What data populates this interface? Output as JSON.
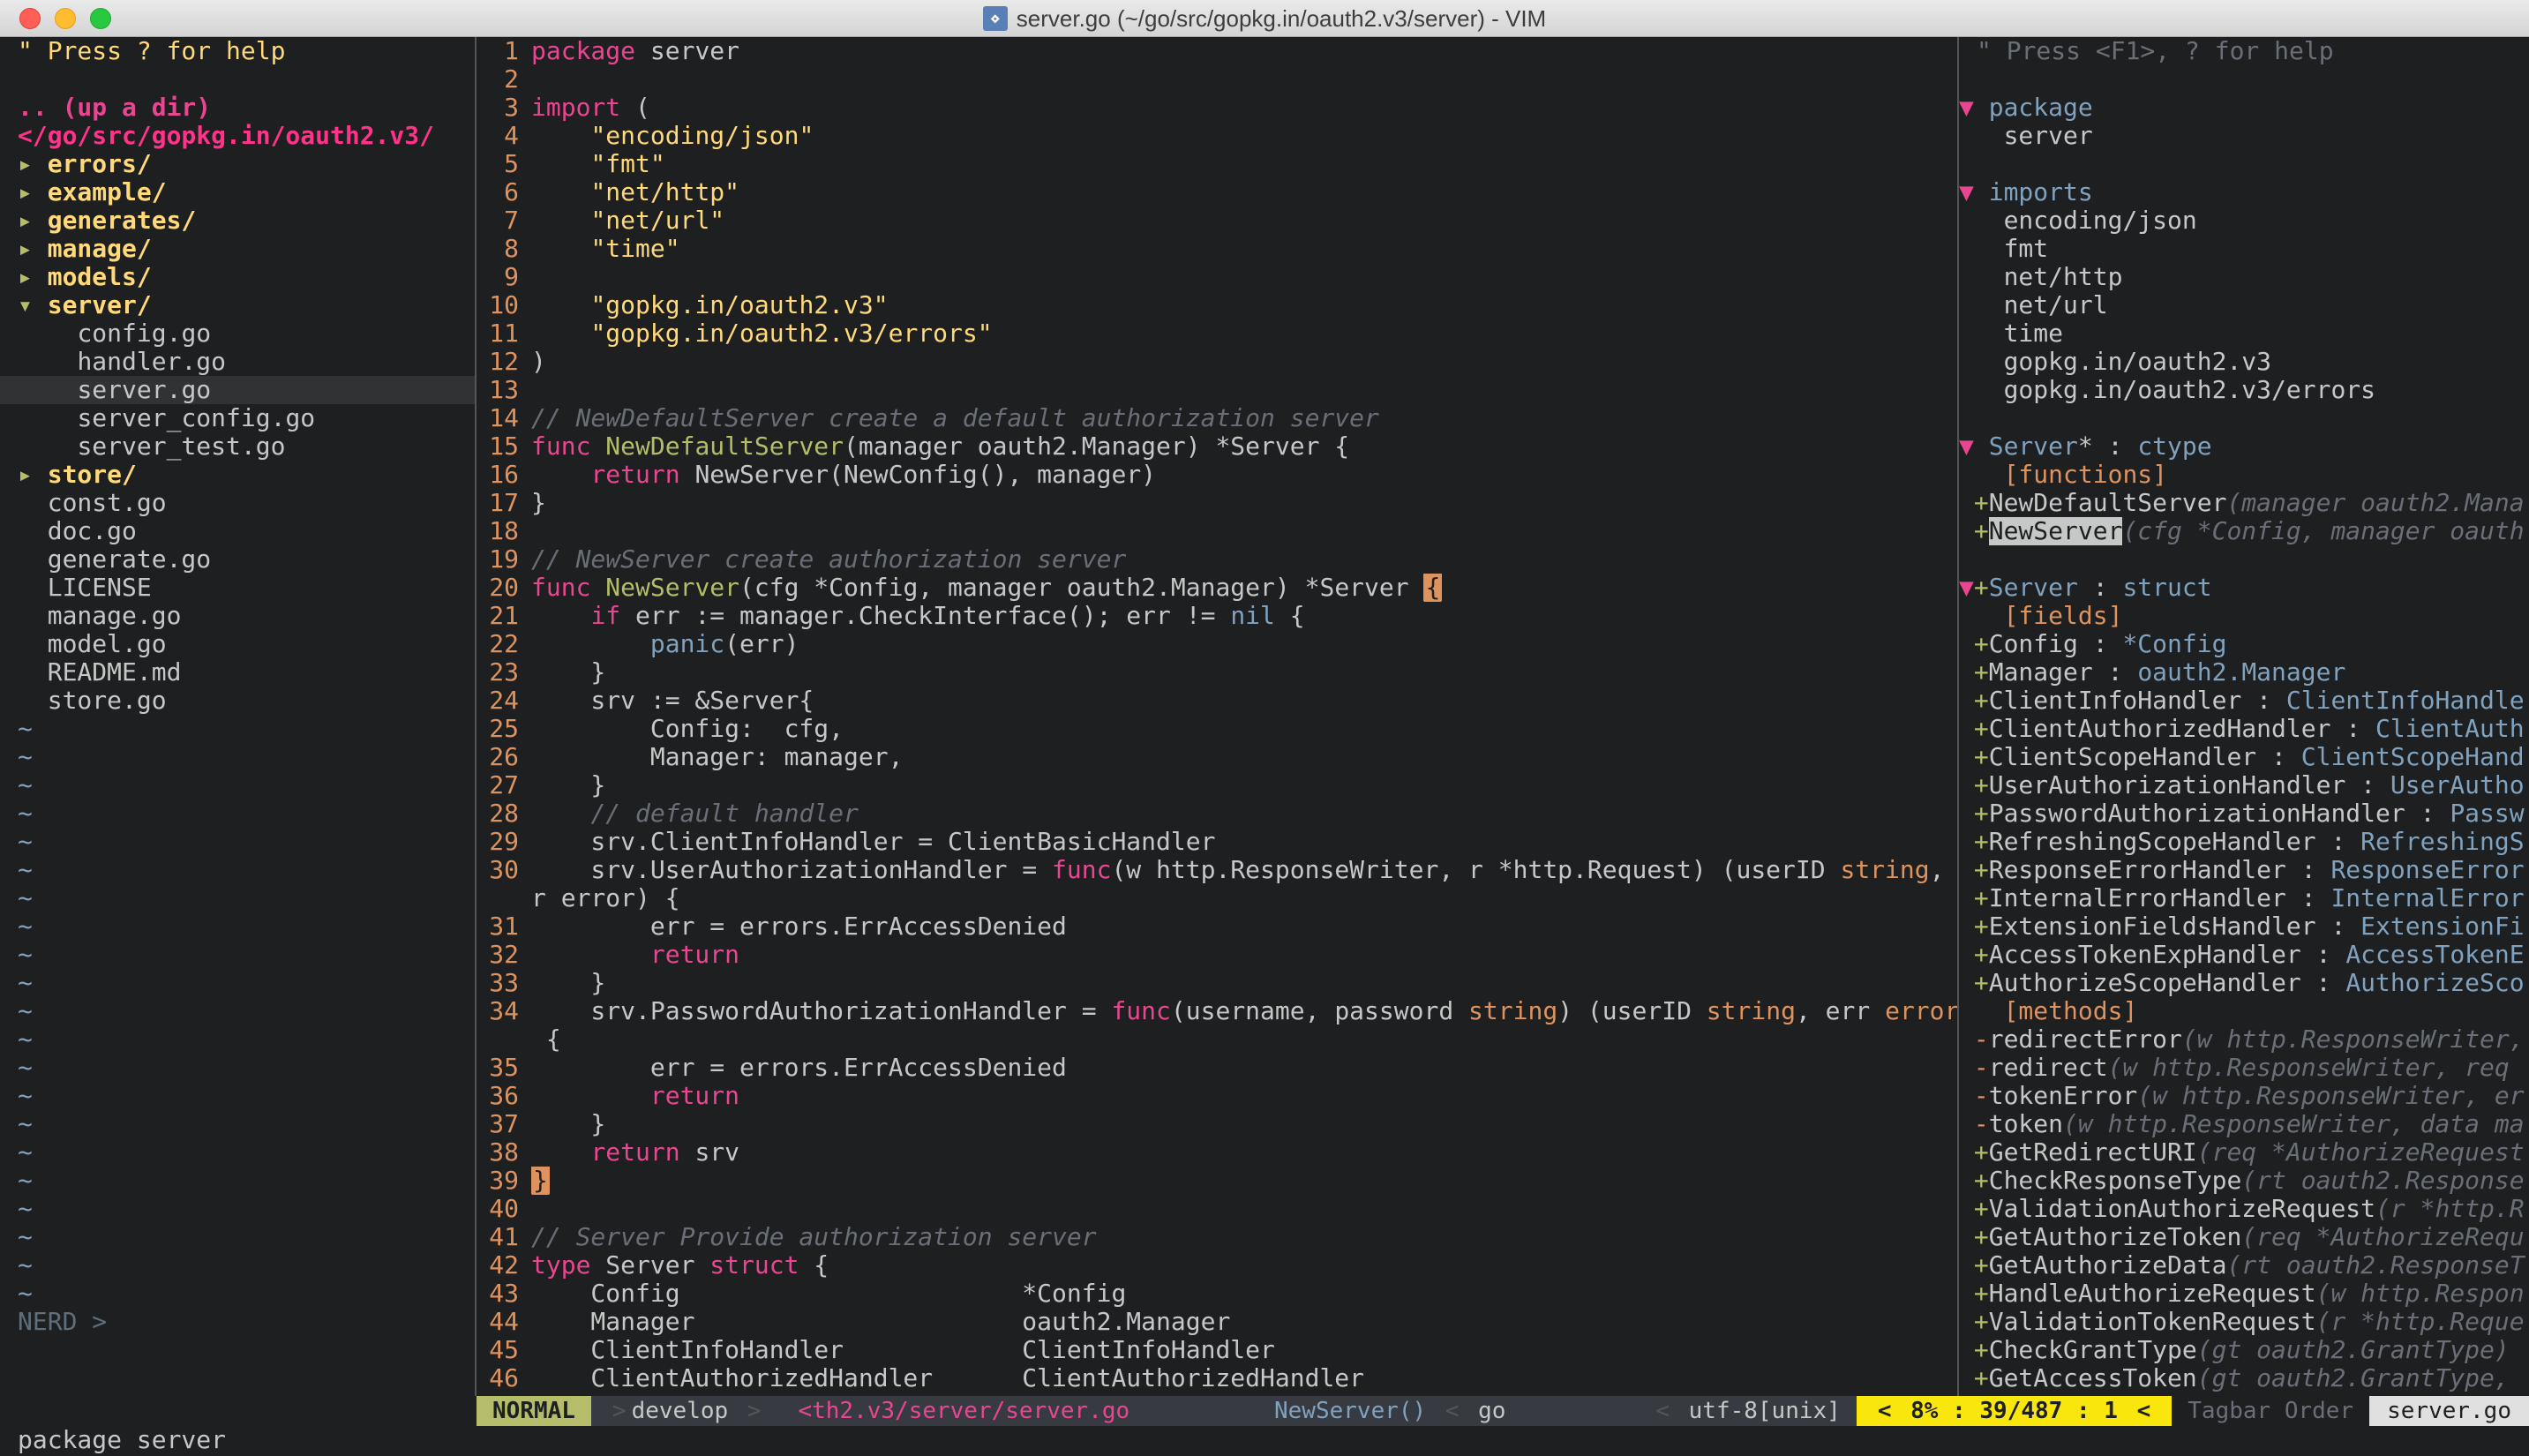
{
  "window": {
    "title": "server.go (~/go/src/gopkg.in/oauth2.v3/server) - VIM"
  },
  "nerd": {
    "help": "\" Press ? for help",
    "updir": ".. (up a dir)",
    "cwd": "</go/src/gopkg.in/oauth2.v3/",
    "entries": [
      {
        "marker": "▸",
        "name": "errors/",
        "type": "dir"
      },
      {
        "marker": "▸",
        "name": "example/",
        "type": "dir"
      },
      {
        "marker": "▸",
        "name": "generates/",
        "type": "dir"
      },
      {
        "marker": "▸",
        "name": "manage/",
        "type": "dir"
      },
      {
        "marker": "▸",
        "name": "models/",
        "type": "dir"
      },
      {
        "marker": "▾",
        "name": "server/",
        "type": "dir"
      },
      {
        "marker": "",
        "name": "config.go",
        "type": "file",
        "indent": 2
      },
      {
        "marker": "",
        "name": "handler.go",
        "type": "file",
        "indent": 2
      },
      {
        "marker": "",
        "name": "server.go",
        "type": "file",
        "indent": 2,
        "selected": true
      },
      {
        "marker": "",
        "name": "server_config.go",
        "type": "file",
        "indent": 2
      },
      {
        "marker": "",
        "name": "server_test.go",
        "type": "file",
        "indent": 2
      },
      {
        "marker": "▸",
        "name": "store/",
        "type": "dir"
      },
      {
        "marker": "",
        "name": "const.go",
        "type": "file",
        "indent": 1
      },
      {
        "marker": "",
        "name": "doc.go",
        "type": "file",
        "indent": 1
      },
      {
        "marker": "",
        "name": "generate.go",
        "type": "file",
        "indent": 1
      },
      {
        "marker": "",
        "name": "LICENSE",
        "type": "file",
        "indent": 1
      },
      {
        "marker": "",
        "name": "manage.go",
        "type": "file",
        "indent": 1
      },
      {
        "marker": "",
        "name": "model.go",
        "type": "file",
        "indent": 1
      },
      {
        "marker": "",
        "name": "README.md",
        "type": "file",
        "indent": 1
      },
      {
        "marker": "",
        "name": "store.go",
        "type": "file",
        "indent": 1
      }
    ],
    "status": "NERD  >"
  },
  "code": {
    "lines": [
      {
        "n": 1,
        "seg": [
          [
            "kw",
            "package"
          ],
          [
            "ident",
            " server"
          ]
        ]
      },
      {
        "n": 2,
        "seg": []
      },
      {
        "n": 3,
        "seg": [
          [
            "kw",
            "import"
          ],
          [
            "ident",
            " ("
          ]
        ]
      },
      {
        "n": 4,
        "seg": [
          [
            "ident",
            "    "
          ],
          [
            "str",
            "\"encoding/json\""
          ]
        ]
      },
      {
        "n": 5,
        "seg": [
          [
            "ident",
            "    "
          ],
          [
            "str",
            "\"fmt\""
          ]
        ]
      },
      {
        "n": 6,
        "seg": [
          [
            "ident",
            "    "
          ],
          [
            "str",
            "\"net/http\""
          ]
        ]
      },
      {
        "n": 7,
        "seg": [
          [
            "ident",
            "    "
          ],
          [
            "str",
            "\"net/url\""
          ]
        ]
      },
      {
        "n": 8,
        "seg": [
          [
            "ident",
            "    "
          ],
          [
            "str",
            "\"time\""
          ]
        ]
      },
      {
        "n": 9,
        "seg": []
      },
      {
        "n": 10,
        "seg": [
          [
            "ident",
            "    "
          ],
          [
            "str",
            "\"gopkg.in/oauth2.v3\""
          ]
        ]
      },
      {
        "n": 11,
        "seg": [
          [
            "ident",
            "    "
          ],
          [
            "str",
            "\"gopkg.in/oauth2.v3/errors\""
          ]
        ]
      },
      {
        "n": 12,
        "seg": [
          [
            "ident",
            ")"
          ]
        ]
      },
      {
        "n": 13,
        "seg": []
      },
      {
        "n": 14,
        "seg": [
          [
            "cmt",
            "// NewDefaultServer create a default authorization server"
          ]
        ]
      },
      {
        "n": 15,
        "seg": [
          [
            "kw",
            "func"
          ],
          [
            "ident",
            " "
          ],
          [
            "fn",
            "NewDefaultServer"
          ],
          [
            "ident",
            "(manager oauth2.Manager) *Server {"
          ]
        ]
      },
      {
        "n": 16,
        "seg": [
          [
            "ident",
            "    "
          ],
          [
            "kw",
            "return"
          ],
          [
            "ident",
            " NewServer(NewConfig(), manager)"
          ]
        ]
      },
      {
        "n": 17,
        "seg": [
          [
            "ident",
            "}"
          ]
        ]
      },
      {
        "n": 18,
        "seg": []
      },
      {
        "n": 19,
        "seg": [
          [
            "cmt",
            "// NewServer create authorization server"
          ]
        ]
      },
      {
        "n": 20,
        "seg": [
          [
            "kw",
            "func"
          ],
          [
            "ident",
            " "
          ],
          [
            "fn",
            "NewServer"
          ],
          [
            "ident",
            "(cfg *Config, manager oauth2.Manager) *Server "
          ],
          [
            "match",
            "{"
          ]
        ]
      },
      {
        "n": 21,
        "seg": [
          [
            "ident",
            "    "
          ],
          [
            "kw",
            "if"
          ],
          [
            "ident",
            " err := manager.CheckInterface(); err != "
          ],
          [
            "nil",
            "nil"
          ],
          [
            "ident",
            " {"
          ]
        ]
      },
      {
        "n": 22,
        "seg": [
          [
            "ident",
            "        "
          ],
          [
            "builtin",
            "panic"
          ],
          [
            "ident",
            "(err)"
          ]
        ]
      },
      {
        "n": 23,
        "seg": [
          [
            "ident",
            "    }"
          ]
        ]
      },
      {
        "n": 24,
        "seg": [
          [
            "ident",
            "    srv := &Server{"
          ]
        ]
      },
      {
        "n": 25,
        "seg": [
          [
            "ident",
            "        Config:  cfg,"
          ]
        ]
      },
      {
        "n": 26,
        "seg": [
          [
            "ident",
            "        Manager: manager,"
          ]
        ]
      },
      {
        "n": 27,
        "seg": [
          [
            "ident",
            "    }"
          ]
        ]
      },
      {
        "n": 28,
        "seg": [
          [
            "ident",
            "    "
          ],
          [
            "cmt",
            "// default handler"
          ]
        ]
      },
      {
        "n": 29,
        "seg": [
          [
            "ident",
            "    srv.ClientInfoHandler = ClientBasicHandler"
          ]
        ]
      },
      {
        "n": 30,
        "seg": [
          [
            "ident",
            "    srv.UserAuthorizationHandler = "
          ],
          [
            "kw",
            "func"
          ],
          [
            "ident",
            "(w http.ResponseWriter, r *http.Request) (userID "
          ],
          [
            "typ",
            "string"
          ],
          [
            "ident",
            ", er"
          ]
        ],
        "wrap": "r error) {"
      },
      {
        "n": 31,
        "seg": [
          [
            "ident",
            "        err = errors.ErrAccessDenied"
          ]
        ]
      },
      {
        "n": 32,
        "seg": [
          [
            "ident",
            "        "
          ],
          [
            "kw",
            "return"
          ]
        ]
      },
      {
        "n": 33,
        "seg": [
          [
            "ident",
            "    }"
          ]
        ]
      },
      {
        "n": 34,
        "seg": [
          [
            "ident",
            "    srv.PasswordAuthorizationHandler = "
          ],
          [
            "kw",
            "func"
          ],
          [
            "ident",
            "(username, password "
          ],
          [
            "typ",
            "string"
          ],
          [
            "ident",
            ") (userID "
          ],
          [
            "typ",
            "string"
          ],
          [
            "ident",
            ", err "
          ],
          [
            "typ",
            "error"
          ],
          [
            "ident",
            ")"
          ]
        ],
        "wrap": " {"
      },
      {
        "n": 35,
        "seg": [
          [
            "ident",
            "        err = errors.ErrAccessDenied"
          ]
        ]
      },
      {
        "n": 36,
        "seg": [
          [
            "ident",
            "        "
          ],
          [
            "kw",
            "return"
          ]
        ]
      },
      {
        "n": 37,
        "seg": [
          [
            "ident",
            "    }"
          ]
        ]
      },
      {
        "n": 38,
        "seg": [
          [
            "ident",
            "    "
          ],
          [
            "kw",
            "return"
          ],
          [
            "ident",
            " srv"
          ]
        ]
      },
      {
        "n": 39,
        "seg": [
          [
            "match",
            "}"
          ]
        ]
      },
      {
        "n": 40,
        "seg": []
      },
      {
        "n": 41,
        "seg": [
          [
            "cmt",
            "// Server Provide authorization server"
          ]
        ]
      },
      {
        "n": 42,
        "seg": [
          [
            "kw",
            "type"
          ],
          [
            "ident",
            " Server "
          ],
          [
            "kw",
            "struct"
          ],
          [
            "ident",
            " {"
          ]
        ]
      },
      {
        "n": 43,
        "seg": [
          [
            "ident",
            "    Config                       *Config"
          ]
        ]
      },
      {
        "n": 44,
        "seg": [
          [
            "ident",
            "    Manager                      oauth2.Manager"
          ]
        ]
      },
      {
        "n": 45,
        "seg": [
          [
            "ident",
            "    ClientInfoHandler            ClientInfoHandler"
          ]
        ]
      },
      {
        "n": 46,
        "seg": [
          [
            "ident",
            "    ClientAuthorizedHandler      ClientAuthorizedHandler"
          ]
        ]
      }
    ]
  },
  "tagbar": {
    "help": "\" Press <F1>, ? for help",
    "sections": [
      {
        "kind": "header",
        "tri": "▼",
        "label": "package"
      },
      {
        "kind": "item",
        "plus": "",
        "text": "server"
      },
      {
        "kind": "blank"
      },
      {
        "kind": "header",
        "tri": "▼",
        "label": "imports"
      },
      {
        "kind": "item",
        "text": "encoding/json"
      },
      {
        "kind": "item",
        "text": "fmt"
      },
      {
        "kind": "item",
        "text": "net/http"
      },
      {
        "kind": "item",
        "text": "net/url"
      },
      {
        "kind": "item",
        "text": "time"
      },
      {
        "kind": "item",
        "text": "gopkg.in/oauth2.v3"
      },
      {
        "kind": "item",
        "text": "gopkg.in/oauth2.v3/errors"
      },
      {
        "kind": "blank"
      },
      {
        "kind": "header",
        "tri": "▼",
        "label": "Server",
        "star": "*",
        "type": "ctype"
      },
      {
        "kind": "section",
        "text": "[functions]"
      },
      {
        "kind": "fn",
        "plus": "+",
        "name": "NewDefaultServer",
        "sig": "(manager oauth2.Mana"
      },
      {
        "kind": "fn",
        "plus": "+",
        "name": "NewServer",
        "hilite": true,
        "sig": "(cfg *Config, manager oauth"
      },
      {
        "kind": "blank"
      },
      {
        "kind": "header",
        "tri": "▼",
        "plus": "+",
        "label": "Server",
        "type": "struct"
      },
      {
        "kind": "section",
        "text": "[fields]"
      },
      {
        "kind": "field",
        "plus": "+",
        "name": "Config",
        "type": "*Config"
      },
      {
        "kind": "field",
        "plus": "+",
        "name": "Manager",
        "type": "oauth2.Manager"
      },
      {
        "kind": "field",
        "plus": "+",
        "name": "ClientInfoHandler",
        "type": "ClientInfoHandle"
      },
      {
        "kind": "field",
        "plus": "+",
        "name": "ClientAuthorizedHandler",
        "type": "ClientAuth"
      },
      {
        "kind": "field",
        "plus": "+",
        "name": "ClientScopeHandler",
        "type": "ClientScopeHand"
      },
      {
        "kind": "field",
        "plus": "+",
        "name": "UserAuthorizationHandler",
        "type": "UserAutho"
      },
      {
        "kind": "field",
        "plus": "+",
        "name": "PasswordAuthorizationHandler",
        "type": "Passw"
      },
      {
        "kind": "field",
        "plus": "+",
        "name": "RefreshingScopeHandler",
        "type": "RefreshingS"
      },
      {
        "kind": "field",
        "plus": "+",
        "name": "ResponseErrorHandler",
        "type": "ResponseError"
      },
      {
        "kind": "field",
        "plus": "+",
        "name": "InternalErrorHandler",
        "type": "InternalError"
      },
      {
        "kind": "field",
        "plus": "+",
        "name": "ExtensionFieldsHandler",
        "type": "ExtensionFi"
      },
      {
        "kind": "field",
        "plus": "+",
        "name": "AccessTokenExpHandler",
        "type": "AccessTokenE"
      },
      {
        "kind": "field",
        "plus": "+",
        "name": "AuthorizeScopeHandler",
        "type": "AuthorizeSco"
      },
      {
        "kind": "section",
        "text": "[methods]"
      },
      {
        "kind": "method",
        "plus": "-",
        "name": "redirectError",
        "sig": "(w http.ResponseWriter,"
      },
      {
        "kind": "method",
        "plus": "-",
        "name": "redirect",
        "sig": "(w http.ResponseWriter, req "
      },
      {
        "kind": "method",
        "plus": "-",
        "name": "tokenError",
        "sig": "(w http.ResponseWriter, er"
      },
      {
        "kind": "method",
        "plus": "-",
        "name": "token",
        "sig": "(w http.ResponseWriter, data ma"
      },
      {
        "kind": "method",
        "plus": "+",
        "name": "GetRedirectURI",
        "sig": "(req *AuthorizeRequest"
      },
      {
        "kind": "method",
        "plus": "+",
        "name": "CheckResponseType",
        "sig": "(rt oauth2.Response"
      },
      {
        "kind": "method",
        "plus": "+",
        "name": "ValidationAuthorizeRequest",
        "sig": "(r *http.R"
      },
      {
        "kind": "method",
        "plus": "+",
        "name": "GetAuthorizeToken",
        "sig": "(req *AuthorizeRequ"
      },
      {
        "kind": "method",
        "plus": "+",
        "name": "GetAuthorizeData",
        "sig": "(rt oauth2.ResponseT"
      },
      {
        "kind": "method",
        "plus": "+",
        "name": "HandleAuthorizeRequest",
        "sig": "(w http.Respon"
      },
      {
        "kind": "method",
        "plus": "+",
        "name": "ValidationTokenRequest",
        "sig": "(r *http.Reque"
      },
      {
        "kind": "method",
        "plus": "+",
        "name": "CheckGrantType",
        "sig": "(gt oauth2.GrantType) "
      },
      {
        "kind": "method",
        "plus": "+",
        "name": "GetAccessToken",
        "sig": "(gt oauth2.GrantType, "
      }
    ],
    "statusbar": "Tagbar   Order   ",
    "statusfile": "server.go"
  },
  "status": {
    "mode": "NORMAL",
    "branch": "develop",
    "file": "<th2.v3/server/server.go",
    "funcname": "NewServer()",
    "langsep": "<",
    "lang": "go",
    "enc": "utf-8[unix]",
    "pos": "8% :  39/487 :  1"
  },
  "cmdline": "package server"
}
